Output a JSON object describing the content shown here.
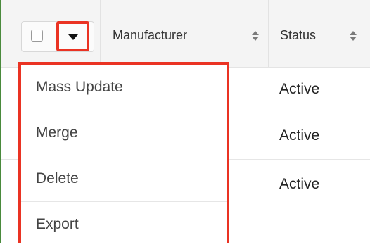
{
  "header": {
    "columns": [
      {
        "label": "Manufacturer"
      },
      {
        "label": "Status"
      }
    ]
  },
  "rows": [
    {
      "status": "Active"
    },
    {
      "status": "Active"
    },
    {
      "status": "Active"
    }
  ],
  "actions_menu": {
    "items": [
      {
        "label": "Mass Update"
      },
      {
        "label": "Merge"
      },
      {
        "label": "Delete"
      },
      {
        "label": "Export"
      }
    ]
  },
  "colors": {
    "highlight": "#ea3323",
    "header_bg": "#f4f4f4",
    "text": "#333333"
  },
  "icons": [
    "checkbox",
    "chevron-down-icon",
    "sort-icon"
  ]
}
